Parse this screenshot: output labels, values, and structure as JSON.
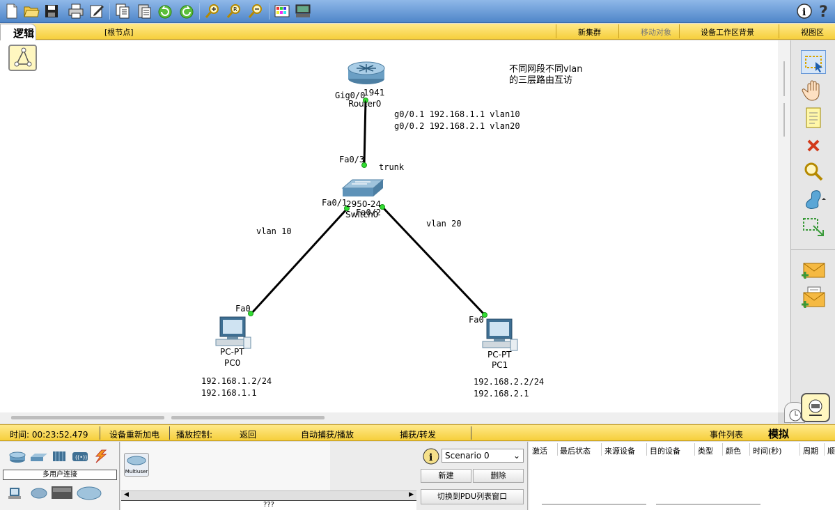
{
  "toolbar": {
    "icons": [
      "new-file-icon",
      "open-folder-icon",
      "save-icon",
      "print-icon",
      "activity-wizard-icon",
      "copy-icon",
      "paste-icon",
      "undo-icon",
      "redo-icon",
      "zoom-in-icon",
      "zoom-reset-icon",
      "zoom-out-icon",
      "palette-icon",
      "custom-device-icon"
    ],
    "info_icon": "info-icon",
    "help_icon": "help-icon"
  },
  "topbar": {
    "logic_tab": "逻辑",
    "root_node": "[根节点]",
    "new_cluster": "新集群",
    "move_object": "移动对象",
    "set_background": "设备工作区背景",
    "viewport": "视图区"
  },
  "topology": {
    "note_line1": "不同网段不同vlan",
    "note_line2": "的三层路由互访",
    "router": {
      "model": "1941",
      "name": "Router0",
      "port": "Gig0/0"
    },
    "router_config_line1": "g0/0.1 192.168.1.1 vlan10",
    "router_config_line2": "g0/0.2 192.168.2.1 vlan20",
    "switch": {
      "model": "2950-24",
      "name": "Switch0",
      "port_uplink": "Fa0/3",
      "port_left": "Fa0/1",
      "port_right": "Fa0/2"
    },
    "trunk_label": "trunk",
    "vlan10_label": "vlan 10",
    "vlan20_label": "vlan 20",
    "pc0": {
      "type": "PC-PT",
      "name": "PC0",
      "port": "Fa0",
      "ip": "192.168.1.2/24",
      "gateway": "192.168.1.1"
    },
    "pc1": {
      "type": "PC-PT",
      "name": "PC1",
      "port": "Fa0",
      "ip": "192.168.2.2/24",
      "gateway": "192.168.2.1"
    }
  },
  "right_tools": [
    "select-icon",
    "move-hand-icon",
    "note-icon",
    "delete-icon",
    "inspect-icon",
    "draw-shape-icon",
    "resize-icon",
    "add-simple-pdu-icon",
    "add-complex-pdu-icon"
  ],
  "status": {
    "time": "时间: 00:23:52.479",
    "power_cycle": "设备重新加电",
    "playback": "播放控制:",
    "back": "返回",
    "auto_capture": "自动捕获/播放",
    "capture_forward": "捕获/转发",
    "event_list": "事件列表",
    "mode": "模拟"
  },
  "devices": {
    "category_label": "多用户连接",
    "multiuser_label": "Multiuser",
    "bottom_text": "???"
  },
  "scenario": {
    "selected": "Scenario 0",
    "new_button": "新建",
    "delete_button": "删除",
    "toggle_button": "切换到PDU列表窗口"
  },
  "events_table": {
    "headers": [
      "激活",
      "最后状态",
      "来源设备",
      "目的设备",
      "类型",
      "颜色",
      "时间(秒)",
      "周期",
      "顺"
    ]
  }
}
